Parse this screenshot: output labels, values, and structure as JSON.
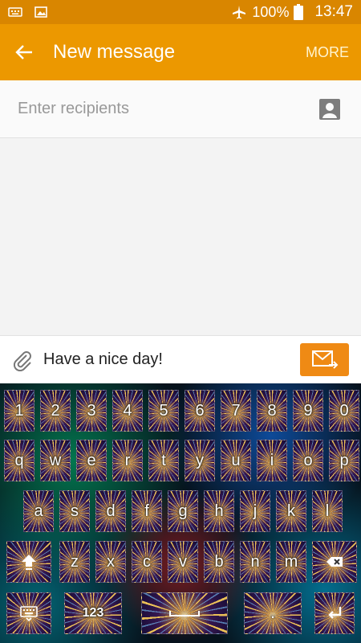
{
  "status_bar": {
    "battery": "100%",
    "time": "13:47"
  },
  "app_bar": {
    "title": "New message",
    "more_label": "MORE"
  },
  "recipients": {
    "placeholder": "Enter recipients"
  },
  "compose": {
    "message": "Have a nice day!"
  },
  "keyboard": {
    "row1": [
      "1",
      "2",
      "3",
      "4",
      "5",
      "6",
      "7",
      "8",
      "9",
      "0"
    ],
    "row2": [
      "q",
      "w",
      "e",
      "r",
      "t",
      "y",
      "u",
      "i",
      "o",
      "p"
    ],
    "row3": [
      "a",
      "s",
      "d",
      "f",
      "g",
      "h",
      "j",
      "k",
      "l"
    ],
    "row4": [
      "z",
      "x",
      "c",
      "v",
      "b",
      "n",
      "m"
    ],
    "numbers_key": "123",
    "space_label": "",
    "period_label": "."
  },
  "colors": {
    "status": "#d98600",
    "appbar": "#ec9800",
    "send": "#ef8a14"
  }
}
